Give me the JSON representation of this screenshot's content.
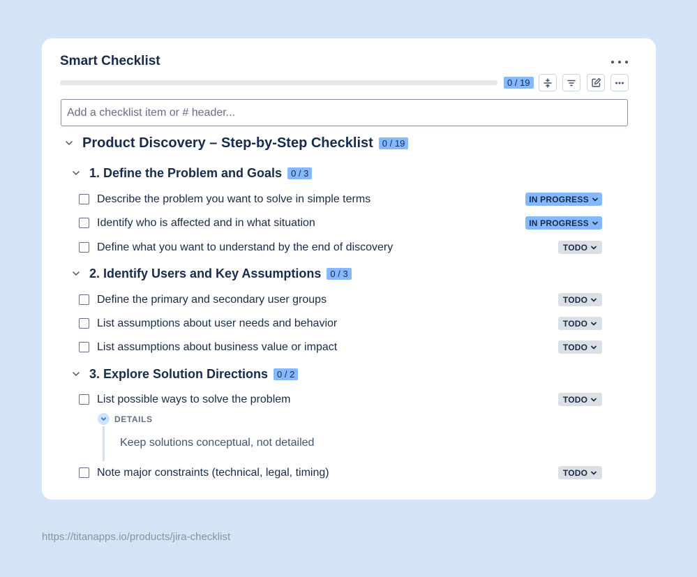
{
  "app": {
    "title": "Smart Checklist"
  },
  "progress": {
    "count": "0 / 19",
    "fraction": 0
  },
  "add_input": {
    "placeholder": "Add a checklist item or # header..."
  },
  "checklist": {
    "title": "Product Discovery – Step-by-Step Checklist",
    "count": "0 / 19",
    "sections": [
      {
        "title": "1. Define the Problem and Goals",
        "count": "0 / 3",
        "items": [
          {
            "text": "Describe the problem you want to solve in simple terms",
            "status": "IN PROGRESS"
          },
          {
            "text": "Identify who is affected and in what situation",
            "status": "IN PROGRESS"
          },
          {
            "text": "Define what you want to understand by the end of discovery",
            "status": "TODO"
          }
        ]
      },
      {
        "title": "2. Identify Users and Key Assumptions",
        "count": "0 / 3",
        "items": [
          {
            "text": "Define the primary and secondary user groups",
            "status": "TODO"
          },
          {
            "text": "List assumptions about user needs and behavior",
            "status": "TODO"
          },
          {
            "text": "List assumptions about business value or impact",
            "status": "TODO"
          }
        ]
      },
      {
        "title": "3. Explore Solution Directions",
        "count": "0 / 2",
        "items": [
          {
            "text": "List possible ways to solve the problem",
            "status": "TODO",
            "details_label": "DETAILS",
            "details_text": "Keep solutions conceptual, not detailed"
          },
          {
            "text": "Note major constraints (technical, legal, timing)",
            "status": "TODO"
          }
        ]
      }
    ]
  },
  "colors": {
    "background": "#d4e3f8",
    "in_progress": "#85b8ff",
    "todo": "#dcdfe4",
    "count_badge": "#85b8ff"
  },
  "icons": {
    "menu": "more-horizontal-icon",
    "collapse": "collapse-icon",
    "filter": "filter-icon",
    "edit": "edit-icon",
    "chevron": "chevron-down-icon"
  },
  "footer": {
    "url": "https://titanapps.io/products/jira-checklist"
  }
}
